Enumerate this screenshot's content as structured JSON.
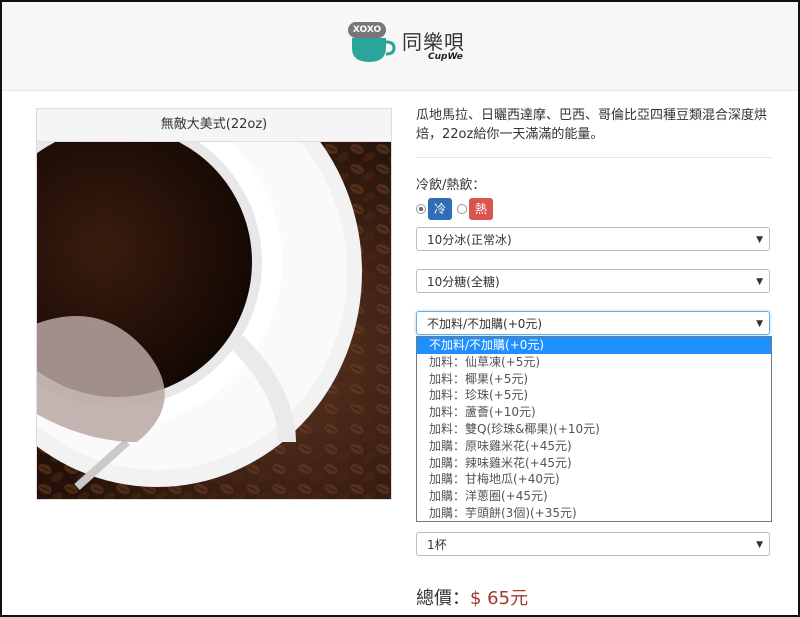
{
  "brand": {
    "badge": "XOXO",
    "name_cn": "同樂唄",
    "name_en": "CupWe"
  },
  "product": {
    "title": "無敵大美式(22oz)",
    "description": "瓜地馬拉、日曬西達摩、巴西、哥倫比亞四種豆類混合深度烘焙，22oz給你一天滿滿的能量。"
  },
  "temperature": {
    "label": "冷飲/熱飲：",
    "cold": {
      "label": "冷",
      "color": "#2f6db5",
      "selected": true
    },
    "hot": {
      "label": "熱",
      "color": "#d9534f",
      "selected": false
    }
  },
  "selects": {
    "ice": "10分冰(正常冰)",
    "sugar": "10分糖(全糖)",
    "addon": "不加料/不加購(+0元)",
    "quantity": "1杯"
  },
  "addon_options": [
    "不加料/不加購(+0元)",
    "加料：仙草凍(+5元)",
    "加料：椰果(+5元)",
    "加料：珍珠(+5元)",
    "加料：蘆薈(+10元)",
    "加料：雙Q(珍珠&椰果)(+10元)",
    "加購：原味雞米花(+45元)",
    "加購：辣味雞米花(+45元)",
    "加購：甘梅地瓜(+40元)",
    "加購：洋蔥圈(+45元)",
    "加購：芋頭餅(3個)(+35元)"
  ],
  "total": {
    "label": "總價：",
    "price": "$ 65元"
  },
  "icons": {
    "dropdown_arrow": "chevron-down-icon",
    "logo": "cup-logo-icon"
  }
}
